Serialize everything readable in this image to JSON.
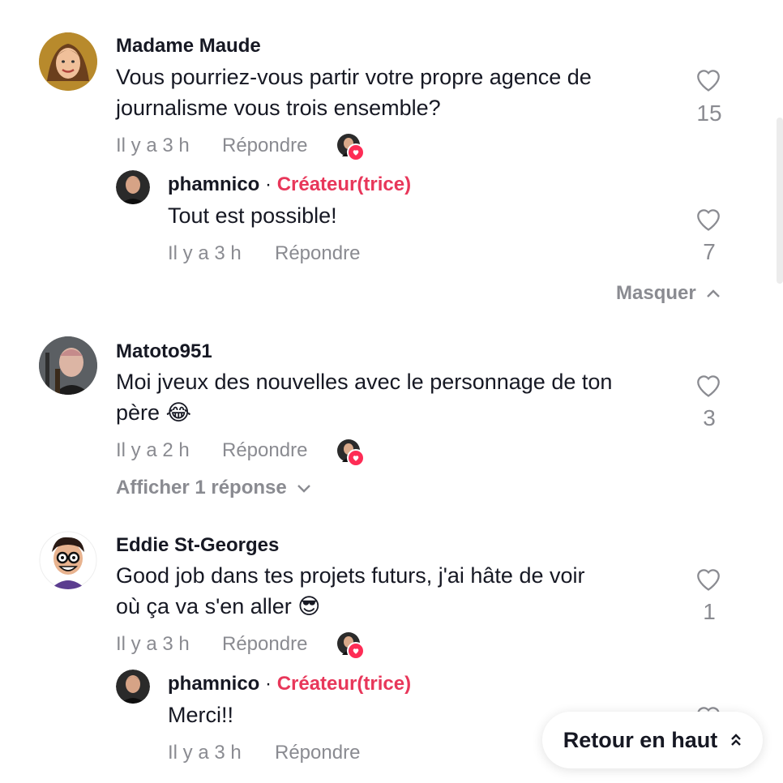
{
  "colors": {
    "creator_accent": "#e8375a",
    "meta_gray": "#8a8b91",
    "text": "#161823",
    "like_heart": "#fe2c55"
  },
  "comments": [
    {
      "author": "Madame Maude",
      "text_line1": "Vous pourriez-vous partir votre propre agence de",
      "text_line2": "journalisme vous trois ensemble?",
      "time": "Il y a 3 h",
      "reply_label": "Répondre",
      "likes": "15",
      "replies": [
        {
          "author": "phamnico",
          "separator": "·",
          "creator_label": "Créateur(trice)",
          "text": "Tout est possible!",
          "time": "Il y a 3 h",
          "reply_label": "Répondre",
          "likes": "7"
        }
      ],
      "collapse_label": "Masquer"
    },
    {
      "author": "Matoto951",
      "text_line1": "Moi jveux des nouvelles avec le personnage de ton",
      "text_line2": "père 😂",
      "time": "Il y a 2 h",
      "reply_label": "Répondre",
      "likes": "3",
      "show_replies_label": "Afficher 1 réponse"
    },
    {
      "author": "Eddie St-Georges",
      "text_line1": "Good job dans tes projets futurs, j'ai hâte de voir",
      "text_line2": "où ça va s'en aller 😎",
      "time": "Il y a 3 h",
      "reply_label": "Répondre",
      "likes": "1",
      "replies": [
        {
          "author": "phamnico",
          "separator": "·",
          "creator_label": "Créateur(trice)",
          "text": "Merci!!",
          "time": "Il y a 3 h",
          "reply_label": "Répondre"
        }
      ]
    }
  ],
  "back_to_top_label": "Retour en haut"
}
